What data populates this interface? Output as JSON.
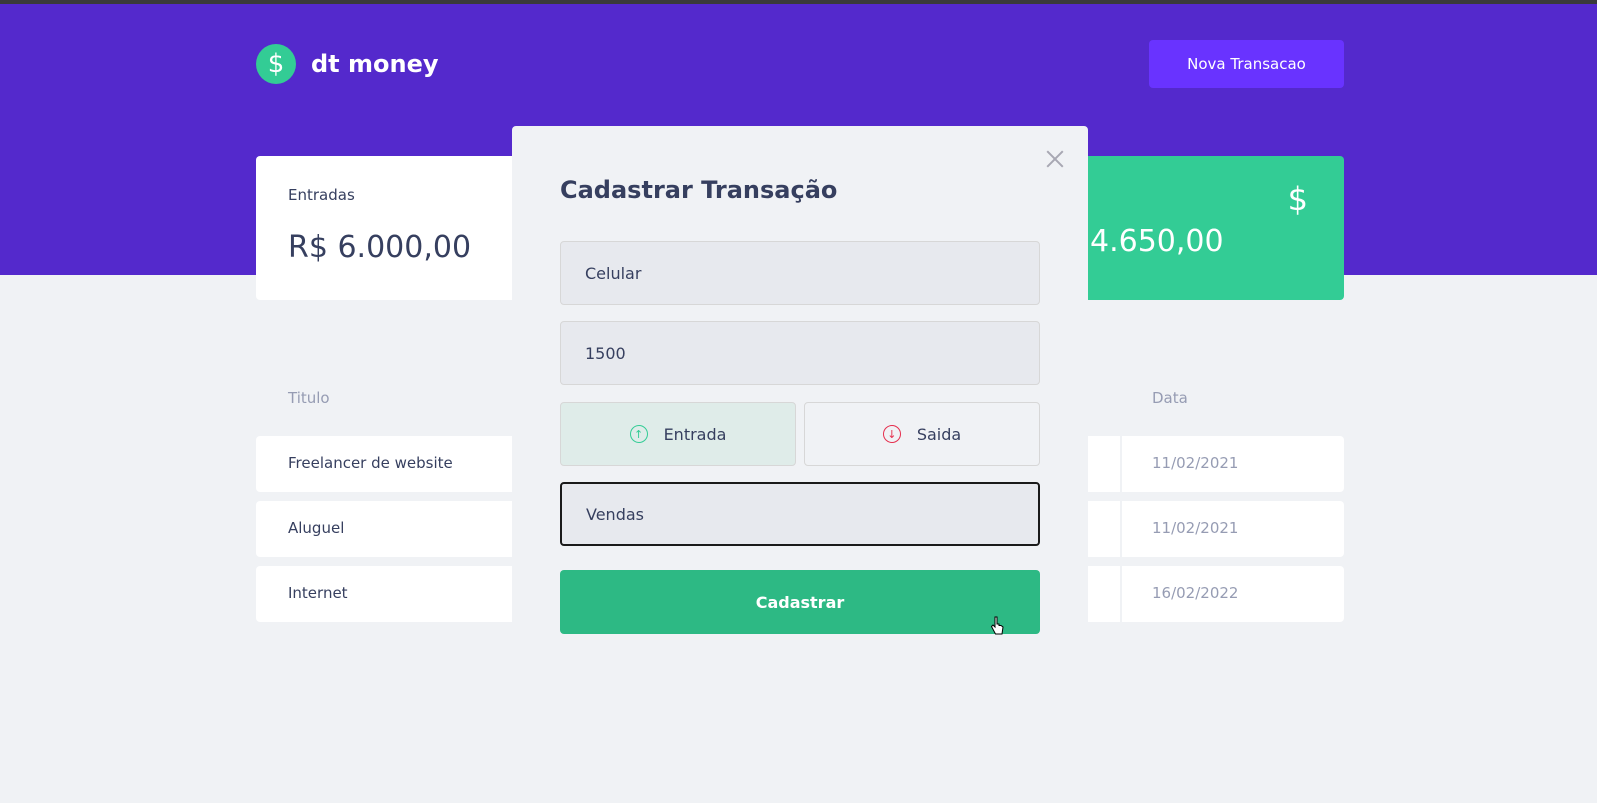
{
  "app": {
    "name": "dt money",
    "logo_icon": "$"
  },
  "header": {
    "new_transaction_label": "Nova Transacao"
  },
  "summary": {
    "income": {
      "label": "Entradas",
      "value": "R$ 6.000,00"
    },
    "total": {
      "value": "4.650,00",
      "icon": "dollar-icon"
    }
  },
  "table": {
    "headers": {
      "title": "Titulo",
      "date": "Data"
    },
    "rows": [
      {
        "title": "Freelancer de website",
        "date": "11/02/2021"
      },
      {
        "title": "Aluguel",
        "date": "11/02/2021"
      },
      {
        "title": "Internet",
        "date": "16/02/2022"
      }
    ]
  },
  "modal": {
    "title": "Cadastrar Transação",
    "fields": {
      "title": "Celular",
      "amount": "1500",
      "category": "Vendas"
    },
    "type_buttons": {
      "income": "Entrada",
      "outcome": "Saida"
    },
    "submit_label": "Cadastrar"
  },
  "colors": {
    "brand": "#5429cc",
    "green": "#33cc95",
    "red": "#e52e4d",
    "button": "#6933ff"
  }
}
